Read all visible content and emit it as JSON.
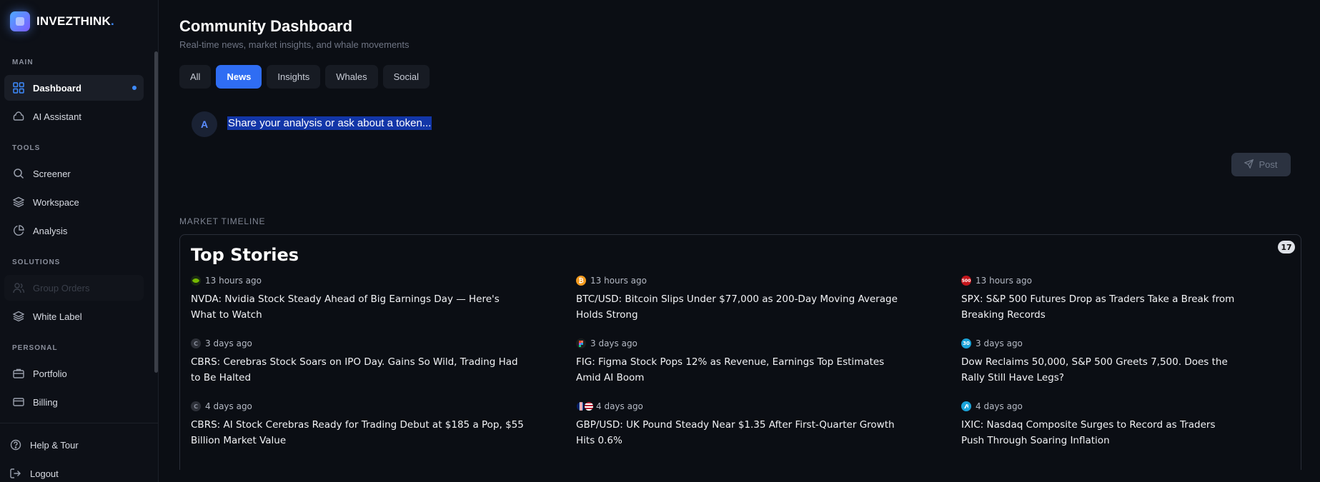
{
  "brand": {
    "name": "INVEZTHINK",
    "dot": "."
  },
  "sidebar": {
    "sections": [
      {
        "label": "MAIN"
      },
      {
        "label": "TOOLS"
      },
      {
        "label": "SOLUTIONS"
      },
      {
        "label": "PERSONAL"
      }
    ],
    "items": {
      "dashboard": "Dashboard",
      "ai_assistant": "AI Assistant",
      "screener": "Screener",
      "workspace": "Workspace",
      "analysis": "Analysis",
      "group_orders": "Group Orders",
      "white_label": "White Label",
      "portfolio": "Portfolio",
      "billing": "Billing",
      "help_tour": "Help & Tour",
      "logout": "Logout"
    }
  },
  "header": {
    "title": "Community Dashboard",
    "subtitle": "Real-time news, market insights, and whale movements"
  },
  "tabs": [
    {
      "label": "All"
    },
    {
      "label": "News",
      "active": true
    },
    {
      "label": "Insights"
    },
    {
      "label": "Whales"
    },
    {
      "label": "Social"
    }
  ],
  "composer": {
    "avatar_initial": "A",
    "placeholder": "Share your analysis or ask about a token...",
    "post_label": "Post"
  },
  "timeline": {
    "label": "MARKET TIMELINE",
    "widget_title": "Top Stories",
    "badge": "17",
    "stories": [
      {
        "icon": "nvidia-icon",
        "time": "13 hours ago",
        "headline": "NVDA: Nvidia Stock Steady Ahead of Big Earnings Day — Here's What to Watch"
      },
      {
        "icon": "bitcoin-icon",
        "time": "13 hours ago",
        "headline": "BTC/USD: Bitcoin Slips Under $77,000 as 200-Day Moving Average Holds Strong"
      },
      {
        "icon": "sp500-icon",
        "icon_text": "500",
        "time": "13 hours ago",
        "headline": "SPX: S&P 500 Futures Drop as Traders Take a Break from Breaking Records"
      },
      {
        "icon": "cerebras-icon",
        "icon_text": "C",
        "time": "3 days ago",
        "headline": "CBRS: Cerebras Stock Soars on IPO Day. Gains So Wild, Trading Had to Be Halted"
      },
      {
        "icon": "figma-icon",
        "time": "3 days ago",
        "headline": "FIG: Figma Stock Pops 12% as Revenue, Earnings Top Estimates Amid AI Boom"
      },
      {
        "icon": "dow30-icon",
        "icon_text": "30",
        "time": "3 days ago",
        "headline": "Dow Reclaims 50,000, S&P 500 Greets 7,500. Does the Rally Still Have Legs?"
      },
      {
        "icon": "cerebras-icon",
        "icon_text": "C",
        "time": "4 days ago",
        "headline": "CBRS: AI Stock Cerebras Ready for Trading Debut at $185 a Pop, $55 Billion Market Value"
      },
      {
        "icon": "gbp-usd-flags-icon",
        "time": "4 days ago",
        "headline": "GBP/USD: UK Pound Steady Near $1.35 After First-Quarter Growth Hits 0.6%"
      },
      {
        "icon": "nasdaq-icon",
        "time": "4 days ago",
        "headline": "IXIC: Nasdaq Composite Surges to Record as Traders Push Through Soaring Inflation"
      }
    ]
  },
  "colors": {
    "accent": "#2f6df3",
    "background": "#0b0e14"
  }
}
